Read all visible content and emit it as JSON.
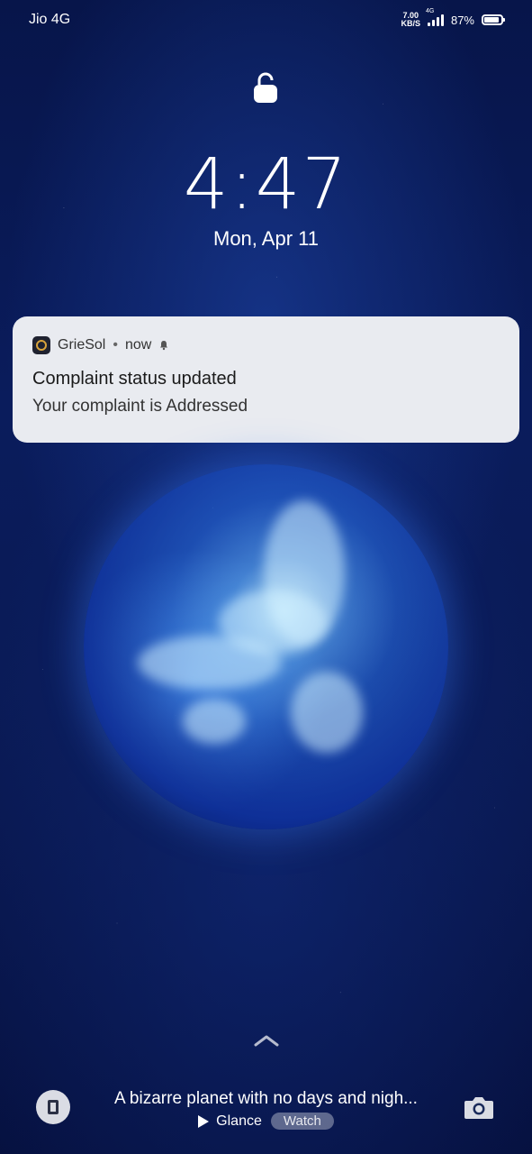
{
  "status_bar": {
    "carrier": "Jio 4G",
    "net_speed_value": "7.00",
    "net_speed_unit": "KB/S",
    "network_type": "4G",
    "battery_percent": "87%",
    "battery_level": 0.87
  },
  "lock_screen": {
    "time": "4:47",
    "date": "Mon, Apr 11"
  },
  "notification": {
    "app_name": "GrieSol",
    "separator": "•",
    "time": "now",
    "title": "Complaint status updated",
    "body": "Your complaint is Addressed"
  },
  "glance": {
    "caption": "A bizarre planet with no days and nigh...",
    "brand": "Glance",
    "watch_label": "Watch"
  },
  "icons": [
    "lock-icon",
    "bell-icon",
    "chevron-up-icon",
    "glance-doc-icon",
    "play-icon",
    "camera-icon",
    "signal-icon",
    "battery-icon"
  ],
  "colors": {
    "background": "#0a1c5c",
    "notification_bg": "#e9ebf0",
    "planet": "#3a8bff"
  }
}
